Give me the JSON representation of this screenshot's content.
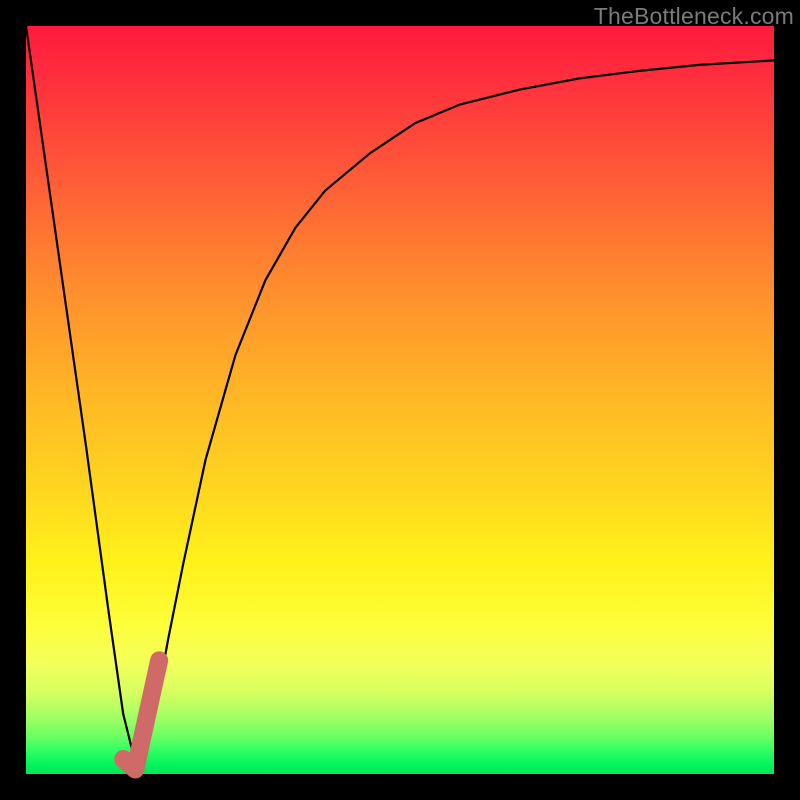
{
  "watermark": "TheBottleneck.com",
  "chart_data": {
    "type": "line",
    "title": "",
    "xlabel": "",
    "ylabel": "",
    "xlim": [
      0,
      100
    ],
    "ylim": [
      0,
      100
    ],
    "grid": false,
    "series": [
      {
        "name": "bottleneck-curve",
        "color": "#000000",
        "width": 2.2,
        "x": [
          0,
          4,
          8,
          11,
          13,
          15,
          17,
          19,
          21,
          24,
          28,
          32,
          36,
          40,
          46,
          52,
          58,
          66,
          74,
          82,
          90,
          100
        ],
        "y": [
          100,
          72,
          44,
          22,
          8,
          0,
          7,
          18,
          28,
          42,
          56,
          66,
          73,
          78,
          83,
          87,
          89.5,
          91.5,
          93,
          94,
          94.8,
          95.4
        ]
      },
      {
        "name": "check-mark",
        "color": "#cf6a68",
        "width": 18,
        "linecap": "round",
        "x": [
          13.0,
          14.6,
          17.8
        ],
        "y": [
          2.0,
          0.6,
          15.2
        ]
      }
    ]
  }
}
